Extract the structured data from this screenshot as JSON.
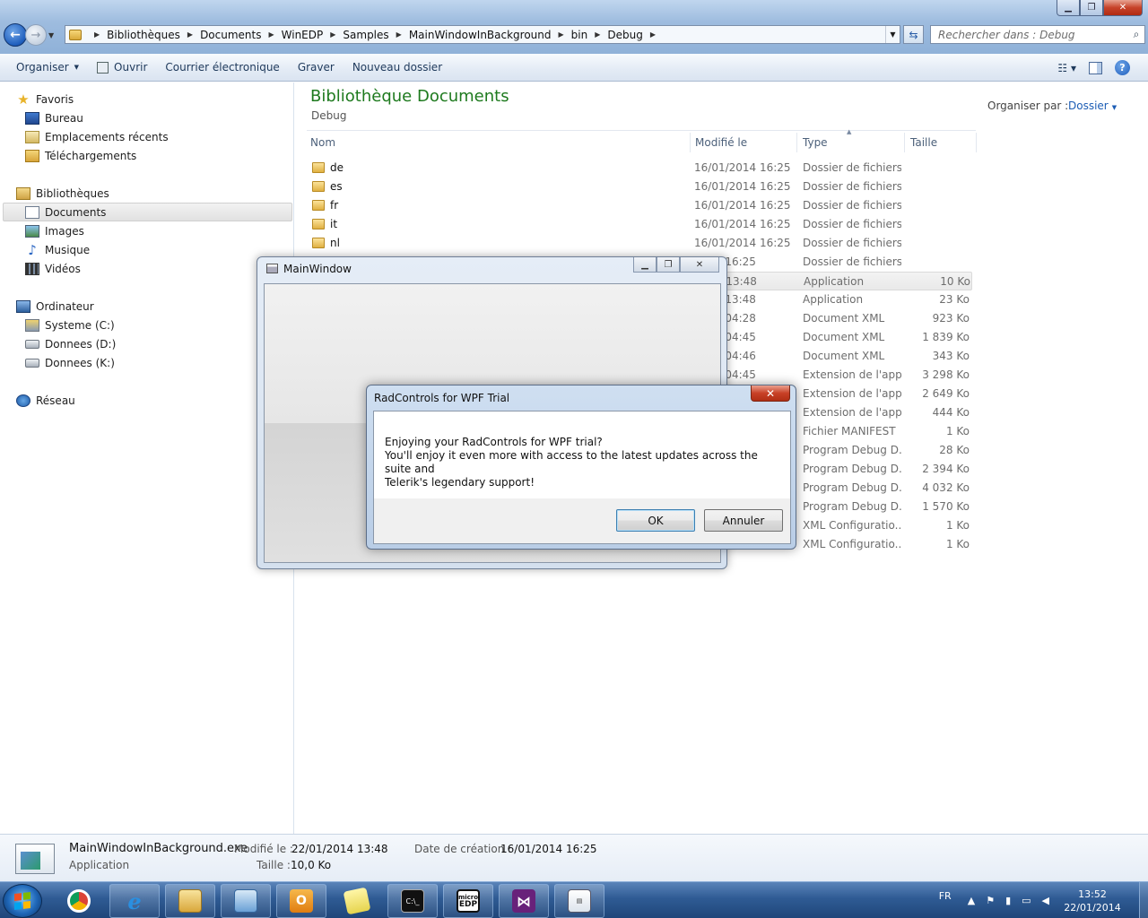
{
  "address": {
    "crumbs": [
      "Bibliothèques",
      "Documents",
      "WinEDP",
      "Samples",
      "MainWindowInBackground",
      "bin",
      "Debug"
    ],
    "search_placeholder": "Rechercher dans : Debug"
  },
  "toolbar": {
    "organize": "Organiser",
    "open": "Ouvrir",
    "email": "Courrier électronique",
    "burn": "Graver",
    "new_folder": "Nouveau dossier"
  },
  "nav": {
    "favorites": "Favoris",
    "desktop": "Bureau",
    "recent": "Emplacements récents",
    "downloads": "Téléchargements",
    "libraries": "Bibliothèques",
    "documents": "Documents",
    "images": "Images",
    "music": "Musique",
    "videos": "Vidéos",
    "computer": "Ordinateur",
    "drive_c": "Systeme (C:)",
    "drive_d": "Donnees (D:)",
    "drive_k": "Donnees (K:)",
    "network": "Réseau"
  },
  "content": {
    "title": "Bibliothèque Documents",
    "subtitle": "Debug",
    "arrange_label": "Organiser par :",
    "arrange_value": "Dossier",
    "columns": {
      "name": "Nom",
      "modified": "Modifié le",
      "type": "Type",
      "size": "Taille"
    },
    "files": [
      {
        "name": "de",
        "modified": "16/01/2014 16:25",
        "type": "Dossier de fichiers",
        "size": ""
      },
      {
        "name": "es",
        "modified": "16/01/2014 16:25",
        "type": "Dossier de fichiers",
        "size": ""
      },
      {
        "name": "fr",
        "modified": "16/01/2014 16:25",
        "type": "Dossier de fichiers",
        "size": ""
      },
      {
        "name": "it",
        "modified": "16/01/2014 16:25",
        "type": "Dossier de fichiers",
        "size": ""
      },
      {
        "name": "nl",
        "modified": "16/01/2014 16:25",
        "type": "Dossier de fichiers",
        "size": ""
      },
      {
        "name": "",
        "modified": "2014 16:25",
        "type": "Dossier de fichiers",
        "size": ""
      },
      {
        "name": "",
        "modified": "2014 13:48",
        "type": "Application",
        "size": "10 Ko"
      },
      {
        "name": "",
        "modified": "2014 13:48",
        "type": "Application",
        "size": "23 Ko"
      },
      {
        "name": "",
        "modified": "2013 04:28",
        "type": "Document XML",
        "size": "923 Ko"
      },
      {
        "name": "",
        "modified": "2013 04:45",
        "type": "Document XML",
        "size": "1 839 Ko"
      },
      {
        "name": "",
        "modified": "2013 04:46",
        "type": "Document XML",
        "size": "343 Ko"
      },
      {
        "name": "",
        "modified": "2013 04:45",
        "type": "Extension de l'app...",
        "size": "3 298 Ko"
      },
      {
        "name": "",
        "modified": "",
        "type": "Extension de l'app...",
        "size": "2 649 Ko"
      },
      {
        "name": "",
        "modified": "",
        "type": "Extension de l'app...",
        "size": "444 Ko"
      },
      {
        "name": "",
        "modified": "",
        "type": "Fichier MANIFEST",
        "size": "1 Ko"
      },
      {
        "name": "",
        "modified": "",
        "type": "Program Debug D...",
        "size": "28 Ko"
      },
      {
        "name": "",
        "modified": "",
        "type": "Program Debug D...",
        "size": "2 394 Ko"
      },
      {
        "name": "",
        "modified": "",
        "type": "Program Debug D...",
        "size": "4 032 Ko"
      },
      {
        "name": "",
        "modified": "",
        "type": "Program Debug D...",
        "size": "1 570 Ko"
      },
      {
        "name": "",
        "modified": "",
        "type": "XML Configuratio...",
        "size": "1 Ko"
      },
      {
        "name": "",
        "modified": "",
        "type": "XML Configuratio...",
        "size": "1 Ko"
      }
    ]
  },
  "details": {
    "filename": "MainWindowInBackground.exe",
    "kind": "Application",
    "modified_label": "Modifié le :",
    "modified_value": "22/01/2014 13:48",
    "size_label": "Taille :",
    "size_value": "10,0 Ko",
    "created_label": "Date de création :",
    "created_value": "16/01/2014 16:25"
  },
  "main_window": {
    "title": "MainWindow"
  },
  "trial_dialog": {
    "title": "RadControls for WPF Trial",
    "line1": "Enjoying your RadControls for WPF trial?",
    "line2": "You'll enjoy it even more with access to the latest updates across the suite and",
    "line3": "Telerik's legendary support!",
    "ok": "OK",
    "cancel": "Annuler"
  },
  "taskbar": {
    "lang": "FR",
    "time": "13:52",
    "date": "22/01/2014",
    "console_label": "C:\\_",
    "micro_label": "micro",
    "edp_label": "EDP"
  },
  "colors": {
    "accent_title": "#1e7a1e",
    "link_blue": "#1c5db5",
    "taskbar": "#2f5b94"
  }
}
